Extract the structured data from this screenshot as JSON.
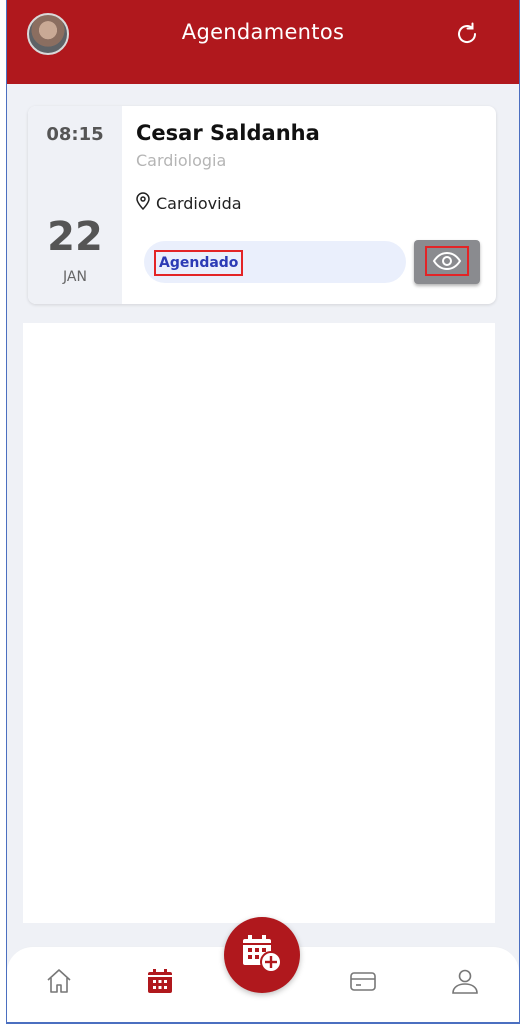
{
  "header": {
    "title": "Agendamentos",
    "avatar_icon": "user-photo",
    "refresh_icon": "refresh-icon",
    "background_color": "#b0181d"
  },
  "appointment": {
    "time": "08:15",
    "day": "22",
    "month": "JAN",
    "doctor": "Cesar Saldanha",
    "specialty": "Cardiologia",
    "location": "Cardiovida",
    "status": "Agendado",
    "status_color": "#2c3bb5",
    "view_icon": "eye-icon"
  },
  "bottom_nav": {
    "items": [
      {
        "name": "home",
        "icon": "home-icon"
      },
      {
        "name": "schedule",
        "icon": "calendar-icon",
        "active": true
      },
      {
        "name": "payments",
        "icon": "card-icon"
      },
      {
        "name": "profile",
        "icon": "user-icon"
      }
    ],
    "fab_icon": "calendar-add-icon",
    "active_color": "#b0181d"
  }
}
